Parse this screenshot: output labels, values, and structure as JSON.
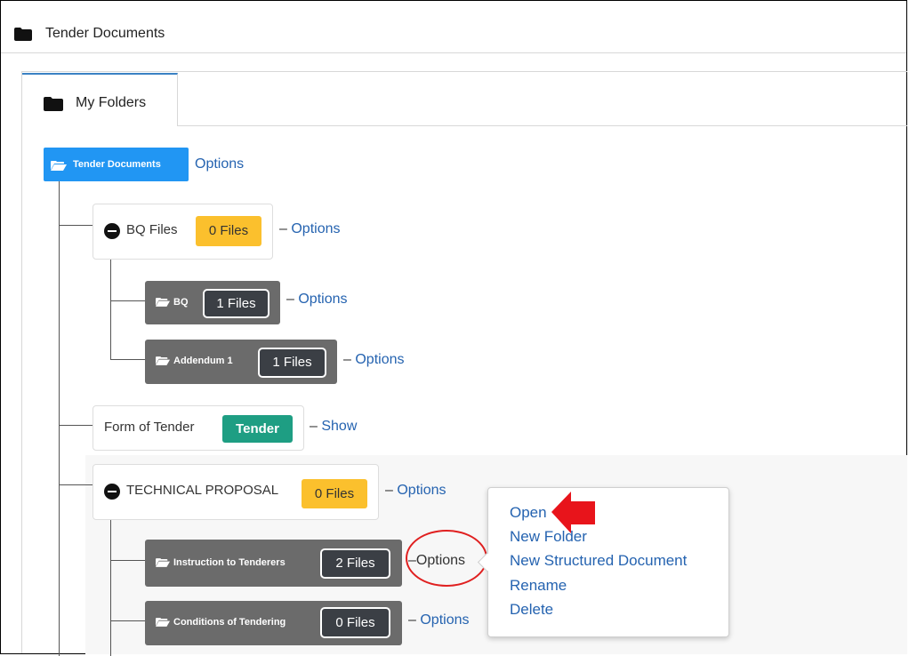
{
  "header": {
    "title": "Tender Documents",
    "icon": "folder-icon"
  },
  "tabs": [
    {
      "label": "My Folders",
      "icon": "folder-icon"
    }
  ],
  "tree": {
    "root": {
      "label": "Tender Documents",
      "options_label": "Options",
      "icon": "folder-open-icon"
    },
    "bq_files": {
      "label": "BQ Files",
      "badge": "0 Files",
      "options_label": "Options"
    },
    "bq": {
      "label": "BQ",
      "badge": "1 Files",
      "options_label": "Options"
    },
    "addendum1": {
      "label": "Addendum 1",
      "badge": "1 Files",
      "options_label": "Options"
    },
    "form_of_tender": {
      "label": "Form of Tender",
      "badge": "Tender",
      "action_label": "Show"
    },
    "technical_proposal": {
      "label": "TECHNICAL PROPOSAL",
      "badge": "0 Files",
      "options_label": "Options"
    },
    "instruction": {
      "label": "Instruction to Tenderers",
      "badge": "2 Files",
      "options_label": "Options"
    },
    "conditions": {
      "label": "Conditions of Tendering",
      "badge": "0 Files",
      "options_label": "Options"
    },
    "dash": "–"
  },
  "context_menu": {
    "items": [
      "Open",
      "New Folder",
      "New Structured Document",
      "Rename",
      "Delete"
    ]
  },
  "colors": {
    "primary": "#2196f3",
    "warning": "#fbc02d",
    "success": "#1e9e83",
    "dark_node": "#6b6b6b",
    "link": "#2563b0",
    "annotation": "#e02020"
  }
}
